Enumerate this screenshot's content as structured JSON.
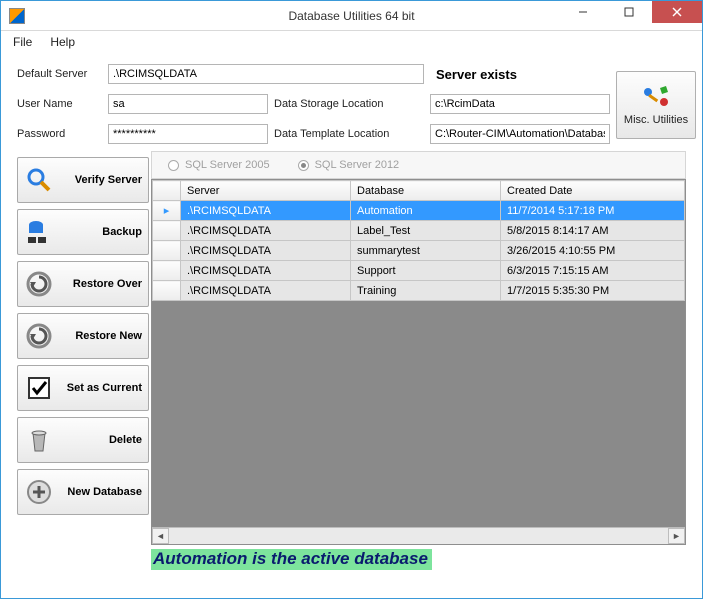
{
  "window": {
    "title": "Database Utilities 64 bit"
  },
  "menu": {
    "file": "File",
    "help": "Help"
  },
  "form": {
    "default_server_label": "Default Server",
    "default_server_value": ".\\RCIMSQLDATA",
    "server_exists": "Server exists",
    "user_name_label": "User Name",
    "user_name_value": "sa",
    "data_storage_label": "Data Storage Location",
    "data_storage_value": "c:\\RcimData",
    "password_label": "Password",
    "password_value": "**********",
    "data_template_label": "Data Template Location",
    "data_template_value": "C:\\Router-CIM\\Automation\\Database\\Ba",
    "misc_utilities": "Misc. Utilities"
  },
  "sql": {
    "opt1": "SQL Server 2005",
    "opt2": "SQL Server 2012"
  },
  "sidebar": {
    "verify": "Verify Server",
    "backup": "Backup",
    "restore_over": "Restore Over",
    "restore_new": "Restore New",
    "set_current": "Set as Current",
    "delete": "Delete",
    "new_db": "New Database"
  },
  "grid": {
    "headers": {
      "server": "Server",
      "database": "Database",
      "created": "Created Date"
    },
    "rows": [
      {
        "server": ".\\RCIMSQLDATA",
        "database": "Automation",
        "created": "11/7/2014 5:17:18 PM",
        "selected": true
      },
      {
        "server": ".\\RCIMSQLDATA",
        "database": "Label_Test",
        "created": "5/8/2015 8:14:17 AM"
      },
      {
        "server": ".\\RCIMSQLDATA",
        "database": "summarytest",
        "created": "3/26/2015 4:10:55 PM"
      },
      {
        "server": ".\\RCIMSQLDATA",
        "database": "Support",
        "created": "6/3/2015 7:15:15 AM"
      },
      {
        "server": ".\\RCIMSQLDATA",
        "database": "Training",
        "created": "1/7/2015 5:35:30 PM"
      }
    ]
  },
  "status": "Automation is the active database"
}
